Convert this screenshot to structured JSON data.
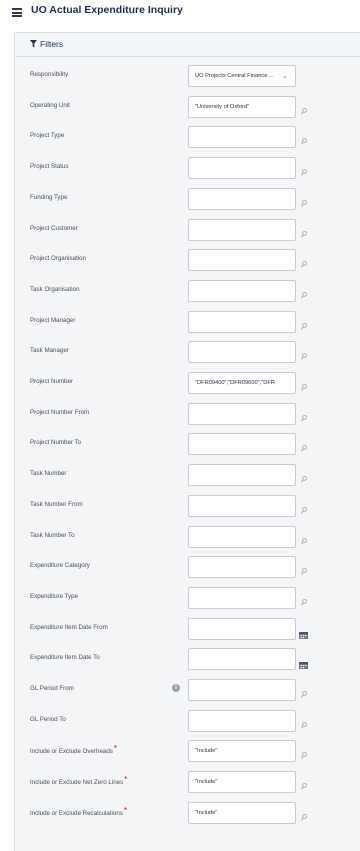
{
  "page": {
    "title": "UO Actual Expenditure Inquiry"
  },
  "icons": {
    "menu": "hamburger-icon",
    "filter": "funnel-icon",
    "lookup": "magnifier-icon",
    "calendar": "calendar-icon",
    "info": "info-icon"
  },
  "filters": {
    "header": "Filters",
    "rows": [
      {
        "label": "Responsibility",
        "type": "select",
        "value": "UO Projects Central Finance ..."
      },
      {
        "label": "Operating Unit",
        "type": "lookup",
        "value": "\"University of Oxford\""
      },
      {
        "label": "Project Type",
        "type": "lookup",
        "value": ""
      },
      {
        "label": "Project Status",
        "type": "lookup",
        "value": ""
      },
      {
        "label": "Funding Type",
        "type": "lookup",
        "value": ""
      },
      {
        "label": "Project Customer",
        "type": "lookup",
        "value": ""
      },
      {
        "label": "Project Organisation",
        "type": "lookup",
        "value": ""
      },
      {
        "label": "Task Organisation",
        "type": "lookup",
        "value": ""
      },
      {
        "label": "Project Manager",
        "type": "lookup",
        "value": ""
      },
      {
        "label": "Task Manager",
        "type": "lookup",
        "value": ""
      },
      {
        "label": "Project Number",
        "type": "lookup",
        "value": "\"DFR09400\",\"DFR09600\",\"DFR"
      },
      {
        "label": "Project Number From",
        "type": "lookup",
        "value": ""
      },
      {
        "label": "Project Number To",
        "type": "lookup",
        "value": ""
      },
      {
        "label": "Task Number",
        "type": "lookup",
        "value": ""
      },
      {
        "label": "Task Number From",
        "type": "lookup",
        "value": ""
      },
      {
        "label": "Task Number To",
        "type": "lookup",
        "value": ""
      },
      {
        "label": "Expenditure Category",
        "type": "lookup",
        "value": ""
      },
      {
        "label": "Expenditure Type",
        "type": "lookup",
        "value": ""
      },
      {
        "label": "Expenditure Item Date From",
        "type": "date",
        "value": ""
      },
      {
        "label": "Expenditure Item Date To",
        "type": "date",
        "value": ""
      },
      {
        "label": "GL Period From",
        "type": "lookup",
        "value": "",
        "info": true
      },
      {
        "label": "GL Period To",
        "type": "lookup",
        "value": ""
      },
      {
        "label": "Include or Exclude Overheads",
        "type": "lookup",
        "value": "\"Include\"",
        "required": true
      },
      {
        "label": "Include or Exclude Net Zero Lines",
        "type": "lookup",
        "value": "\"Include\"",
        "required": true
      },
      {
        "label": "Include or Exclude Recalculations",
        "type": "lookup",
        "value": "\"Include\"",
        "required": true
      }
    ]
  }
}
